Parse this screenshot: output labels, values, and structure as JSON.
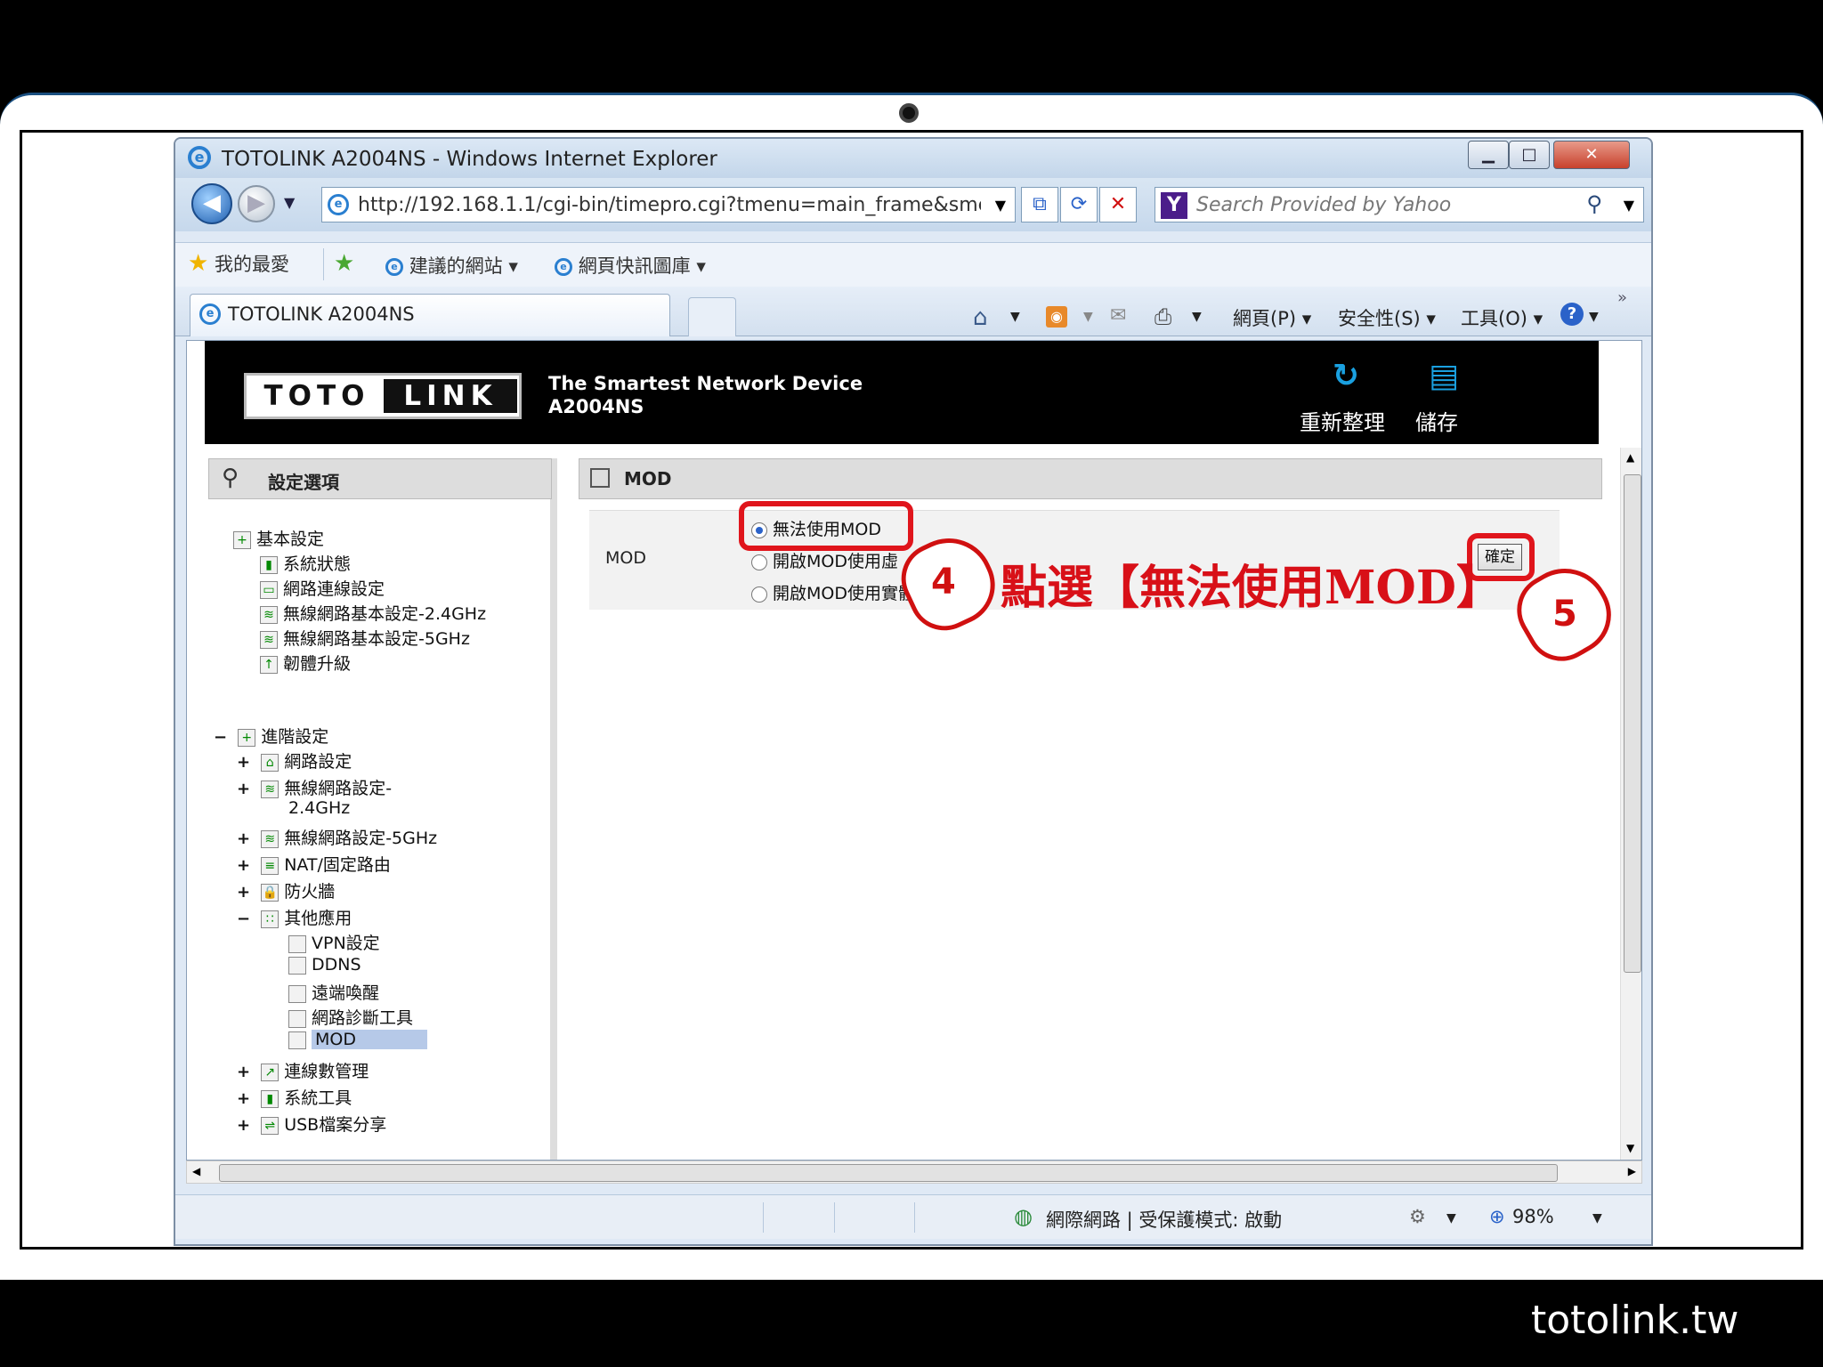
{
  "window": {
    "title": "TOTOLINK A2004NS - Windows Internet Explorer",
    "minimize": "▁",
    "maximize": "□",
    "close": "✕"
  },
  "navbar": {
    "back_glyph": "◀",
    "forward_glyph": "▶",
    "address": "http://192.168.1.1/cgi-bin/timepro.cgi?tmenu=main_frame&smenu=",
    "search_placeholder": "Search Provided by Yahoo",
    "yahoo_icon_label": "Y"
  },
  "favorites": {
    "favorites_label": "我的最愛",
    "suggested_sites": "建議的網站 ▾",
    "web_slice": "網頁快訊圖庫 ▾"
  },
  "tab": {
    "active_title": "TOTOLINK A2004NS"
  },
  "commandbar": {
    "page_menu": "網頁(P) ▾",
    "safety_menu": "安全性(S) ▾",
    "tools_menu": "工具(O) ▾",
    "chevron": "»"
  },
  "router": {
    "logo_left": "TOTO",
    "logo_right": "LINK",
    "tagline_1": "The Smartest Network Device",
    "tagline_2": "A2004NS",
    "refresh_label": "重新整理",
    "save_label": "儲存"
  },
  "sidebar": {
    "header": "設定選項",
    "basic_group": "基本設定",
    "basic_items": [
      "系統狀態",
      "網路連線設定",
      "無線網路基本設定-2.4GHz",
      "無線網路基本設定-5GHz",
      "韌體升級"
    ],
    "advanced_group": "進階設定",
    "adv_network": "網路設定",
    "adv_wireless_24_line1": "無線網路設定-",
    "adv_wireless_24_line2": "2.4GHz",
    "adv_wireless_5": "無線網路設定-5GHz",
    "adv_nat": "NAT/固定路由",
    "adv_firewall": "防火牆",
    "adv_other": "其他應用",
    "other_items": [
      "VPN設定",
      "DDNS",
      "遠端喚醒",
      "網路診斷工具",
      "MOD"
    ],
    "adv_traffic": "連線數管理",
    "adv_systools": "系統工具",
    "adv_usb": "USB檔案分享",
    "plus": "+",
    "minus": "−"
  },
  "main": {
    "header": "MOD",
    "mod_label": "MOD",
    "options": [
      "無法使用MOD",
      "開啟MOD使用虛",
      "開啟MOD使用實體"
    ],
    "selected_option": "無法使用MOD",
    "confirm": "確定"
  },
  "status": {
    "zone": "網際網路 | 受保護模式: 啟動",
    "zoom": "98%"
  },
  "annotation": {
    "step4": "4",
    "step5": "5",
    "instruction": "點選【無法使用MOD】"
  },
  "brand": "totolink.tw"
}
